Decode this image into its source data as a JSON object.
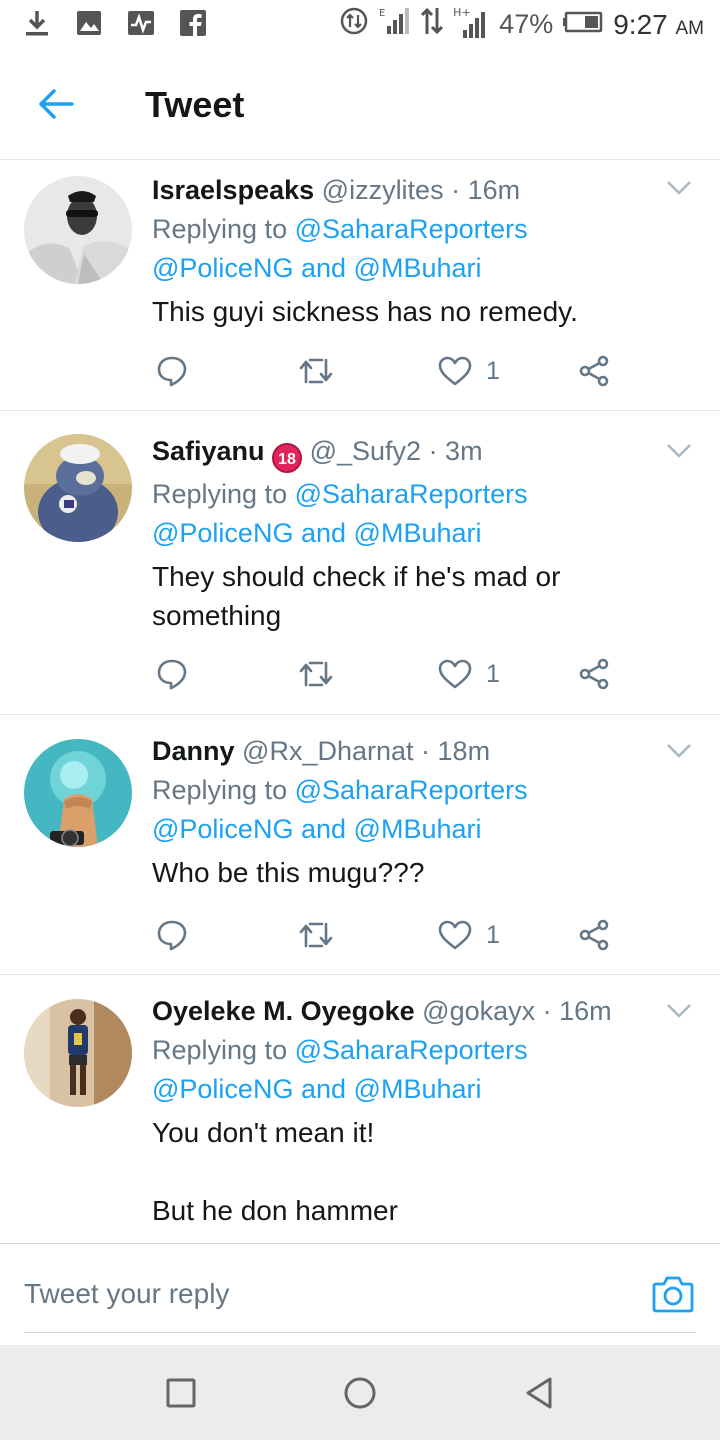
{
  "status_bar": {
    "battery": "47%",
    "time": "9:27",
    "ampm": "AM",
    "network": "H+"
  },
  "header": {
    "title": "Tweet"
  },
  "colors": {
    "accent": "#1da1f2",
    "secondary_text": "#657786",
    "primary_text": "#14171a"
  },
  "tweets": [
    {
      "name": "Israelspeaks",
      "handle": "@izzylites",
      "time": "· 16m",
      "replying_label": "Replying to",
      "mention1": "@SaharaReporters",
      "mention2": "@PoliceNG",
      "and_label": "and",
      "mention3": "@MBuhari",
      "text": "This guyi sickness has no remedy.",
      "likes": "1"
    },
    {
      "name": "Safiyanu",
      "badge": "18",
      "handle": "@_Sufy2",
      "time": "· 3m",
      "replying_label": "Replying to",
      "mention1": "@SaharaReporters",
      "mention2": "@PoliceNG",
      "and_label": "and",
      "mention3": "@MBuhari",
      "text": "They should check if he's mad or something",
      "likes": "1"
    },
    {
      "name": "Danny",
      "handle": "@Rx_Dharnat",
      "time": "· 18m",
      "replying_label": "Replying to",
      "mention1": "@SaharaReporters",
      "mention2": "@PoliceNG",
      "and_label": "and",
      "mention3": "@MBuhari",
      "text": "Who be this mugu???",
      "likes": "1"
    },
    {
      "name": "Oyeleke M. Oyegoke",
      "handle": "@gokayx",
      "time": "· 16m",
      "replying_label": "Replying to",
      "mention1": "@SaharaReporters",
      "mention2": "@PoliceNG",
      "and_label": "and",
      "mention3": "@MBuhari",
      "text": "You don't mean it!\n\nBut he don hammer"
    }
  ],
  "reply_bar": {
    "placeholder": "Tweet your reply"
  },
  "icons": {
    "back": "arrow-left-icon",
    "reply": "speech-bubble-icon",
    "retweet": "retweet-icon",
    "like": "heart-icon",
    "share": "share-icon",
    "more": "chevron-down-icon",
    "camera": "camera-icon"
  }
}
